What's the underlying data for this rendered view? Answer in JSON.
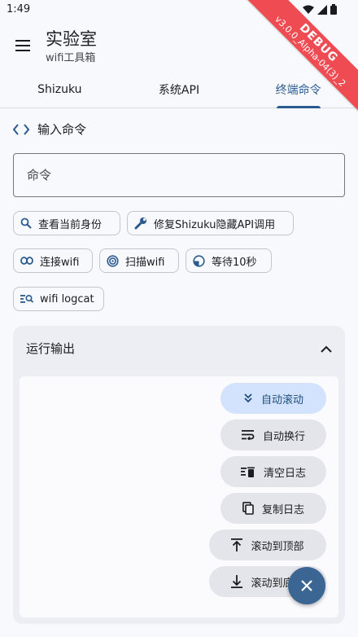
{
  "status_bar": {
    "time": "1:49"
  },
  "debug_ribbon": {
    "label": "DEBUG",
    "version": "v3.0.0_Alpha-04(3)_2"
  },
  "app_bar": {
    "title": "实验室",
    "subtitle": "wifi工具箱"
  },
  "tabs": [
    {
      "label": "Shizuku",
      "active": false
    },
    {
      "label": "系统API",
      "active": false
    },
    {
      "label": "终端命令",
      "active": true
    }
  ],
  "command_section": {
    "title": "输入命令",
    "placeholder": "命令"
  },
  "chips": {
    "check_identity": "查看当前身份",
    "fix_shizuku": "修复Shizuku隐藏API调用",
    "connect_wifi": "连接wifi",
    "scan_wifi": "扫描wifi",
    "wait_10s": "等待10秒",
    "wifi_logcat": "wifi logcat"
  },
  "output": {
    "title": "运行输出",
    "actions": {
      "auto_scroll": "自动滚动",
      "auto_wrap": "自动换行",
      "clear_log": "清空日志",
      "copy_log": "复制日志",
      "scroll_top": "滚动到顶部",
      "scroll_bottom": "滚动到底部"
    }
  },
  "colors": {
    "accent": "#2b5a8f",
    "fab": "#3b6694",
    "ribbon": "#ef4b52"
  }
}
